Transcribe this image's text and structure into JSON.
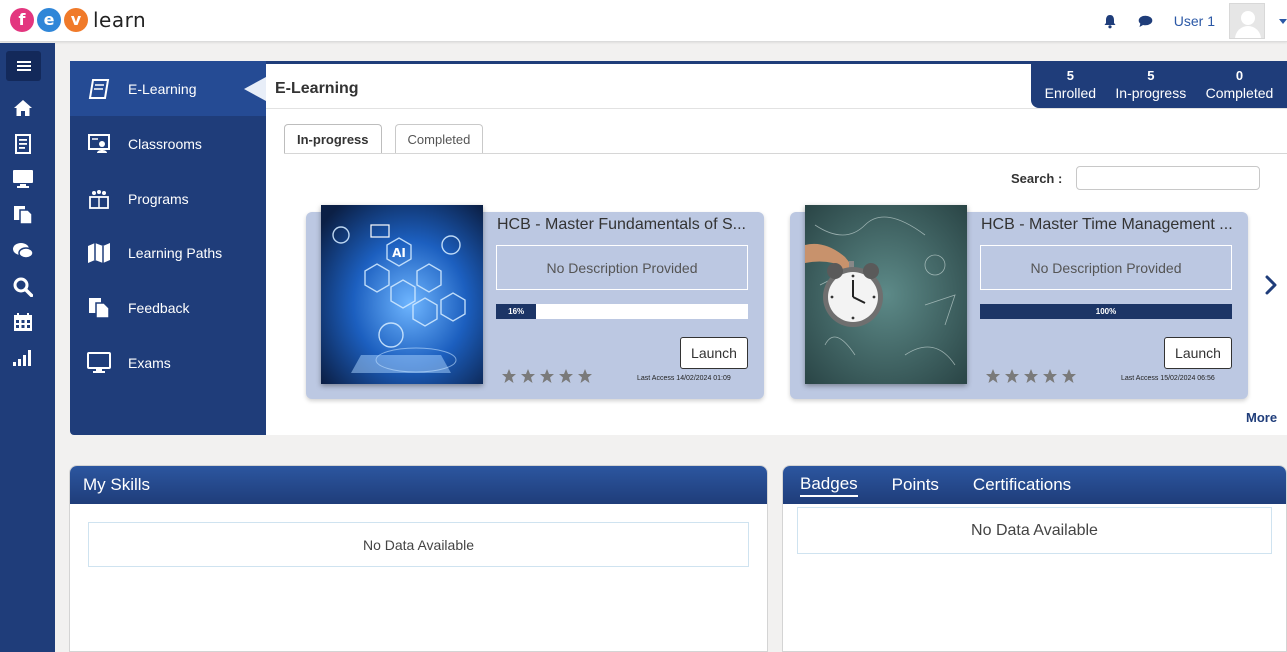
{
  "logo": {
    "letters": [
      "f",
      "e",
      "v"
    ],
    "word": "learn",
    "colors": [
      "#e3367f",
      "#2f86d8",
      "#f07a2a"
    ]
  },
  "topbar": {
    "user_name": "User 1",
    "icons": [
      "bell-icon",
      "chat-icon",
      "avatar",
      "chevron-down-icon"
    ]
  },
  "rail": {
    "icons": [
      "menu-icon",
      "home-icon",
      "course-icon",
      "monitor-icon",
      "document-icon",
      "comments-icon",
      "search-icon",
      "calendar-icon",
      "signal-icon"
    ]
  },
  "sidenav": {
    "items": [
      {
        "label": "E-Learning",
        "icon": "book-icon"
      },
      {
        "label": "Classrooms",
        "icon": "classroom-icon"
      },
      {
        "label": "Programs",
        "icon": "program-icon"
      },
      {
        "label": "Learning Paths",
        "icon": "map-icon"
      },
      {
        "label": "Feedback",
        "icon": "feedback-icon"
      },
      {
        "label": "Exams",
        "icon": "monitor-icon"
      }
    ]
  },
  "main": {
    "title": "E-Learning",
    "stats": [
      {
        "number": "5",
        "label": "Enrolled"
      },
      {
        "number": "5",
        "label": "In-progress"
      },
      {
        "number": "0",
        "label": "Completed"
      }
    ],
    "tabs": [
      "In-progress",
      "Completed"
    ],
    "search_label": "Search :",
    "search_value": "",
    "more_label": "More"
  },
  "courses": [
    {
      "title": "HCB - Master Fundamentals of S...",
      "description": "No Description Provided",
      "progress": 16,
      "progress_label": "16%",
      "launch_label": "Launch",
      "rating": 0,
      "last_access": "Last Access 14/02/2024 01:09"
    },
    {
      "title": "HCB - Master Time Management ...",
      "description": "No Description Provided",
      "progress": 100,
      "progress_label": "100%",
      "launch_label": "Launch",
      "rating": 0,
      "last_access": "Last Access 15/02/2024 06:56"
    }
  ],
  "skills_panel": {
    "title": "My Skills",
    "empty_text": "No Data Available"
  },
  "achievements_panel": {
    "tabs": [
      "Badges",
      "Points",
      "Certifications"
    ],
    "active_tab": "Badges",
    "empty_text": "No Data Available"
  },
  "colors": {
    "navy": "#1f3d7a",
    "card_bg": "#bcc8e2",
    "progress": "#1c3566",
    "link": "#2b58a6"
  }
}
